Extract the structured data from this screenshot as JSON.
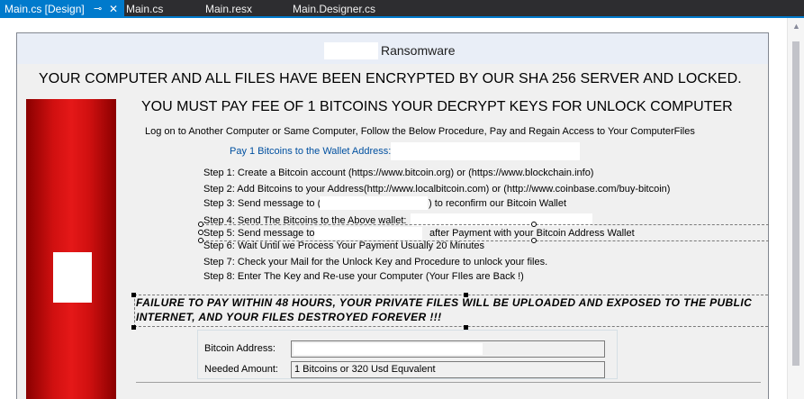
{
  "tabs": [
    {
      "label": "Main.cs [Design]",
      "active": true
    },
    {
      "label": "Main.cs",
      "active": false
    },
    {
      "label": "Main.resx",
      "active": false
    },
    {
      "label": "Main.Designer.cs",
      "active": false
    }
  ],
  "tab_icons": {
    "pin": "pin-icon",
    "close": "close-icon"
  },
  "form": {
    "title": "Ransomware",
    "headline1": "YOUR COMPUTER AND ALL FILES HAVE BEEN ENCRYPTED BY OUR SHA 256 SERVER AND LOCKED.",
    "headline2": "YOU MUST PAY  FEE OF 1 BITCOINS YOUR DECRYPT KEYS FOR UNLOCK COMPUTER",
    "intro": "Log on to Another Computer or Same Computer, Follow the Below Procedure, Pay and Regain Access to Your ComputerFiles",
    "pay_label": "Pay 1 Bitcoins to the Wallet Address:",
    "steps": {
      "s1": "Step 1: Create a Bitcoin account  (https://www.bitcoin.org) or (https://www.blockchain.info)",
      "s2": "Step 2: Add Bitcoins to your Address(http://www.localbitcoin.com) or (http://www.coinbase.com/buy-bitcoin)",
      "s3a": "Step 3: Send message to  (",
      "s3b": ") to reconfirm our Bitcoin Wallet",
      "s4": "Step 4: Send The Bitcoins to the Above wallet:",
      "s5a": "Step 5: Send message to",
      "s5b": "after Payment with your Bitcoin Address Wallet",
      "s6": "Step 6: Wait Until we Process Your Payment Usually 20 Minutes",
      "s7": "Step 7: Check your Mail for the Unlock Key and Procedure to unlock your files.",
      "s8": "Step 8: Enter The Key and Re-use your Computer (Your FIles are Back !)"
    },
    "warning": "FAILURE TO PAY WITHIN 48 HOURS, YOUR PRIVATE FILES WILL BE UPLOADED AND EXPOSED TO THE PUBLIC INTERNET, AND YOUR FILES DESTROYED FOREVER !!!",
    "bitcoin_address_label": "Bitcoin Address:",
    "needed_amount_label": "Needed Amount:",
    "needed_amount_value": "1 Bitcoins  or 320 Usd Equvalent"
  },
  "colors": {
    "accent": "#007acc",
    "red_panel": "#e51818",
    "link": "#0050a0"
  }
}
